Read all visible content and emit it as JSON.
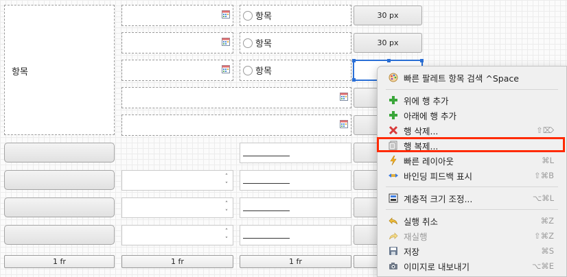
{
  "grid": {
    "left_label": "항목",
    "radio_label": "항목",
    "px_button": "30 px",
    "column_footers": [
      "1 fr",
      "1 fr",
      "1 fr"
    ]
  },
  "menu": {
    "items": [
      {
        "icon": "palette-icon",
        "label": "빠른 팔레트 항목 검색 ^Space",
        "shortcut": ""
      },
      {
        "icon": "add-green-icon",
        "label": "위에 행 추가",
        "shortcut": ""
      },
      {
        "icon": "add-green-icon",
        "label": "아래에 행 추가",
        "shortcut": ""
      },
      {
        "icon": "delete-red-x-icon",
        "label": "행 삭제...",
        "shortcut": "⇧⌦"
      },
      {
        "icon": "duplicate-document-icon",
        "label": "행 복제...",
        "shortcut": ""
      },
      {
        "icon": "lightning-icon",
        "label": "빠른 레이아웃",
        "shortcut": "⌘L"
      },
      {
        "icon": "binding-feedback-icon",
        "label": "바인딩 피드백 표시",
        "shortcut": "⇧⌘B"
      },
      {
        "icon": "resize-hierarchy-icon",
        "label": "계층적 크기 조정...",
        "shortcut": "⌥⌘L"
      },
      {
        "icon": "undo-icon",
        "label": "실행 취소",
        "shortcut": "⌘Z"
      },
      {
        "icon": "redo-icon",
        "label": "재실행",
        "shortcut": "⇧⌘Z",
        "disabled": true
      },
      {
        "icon": "save-disk-icon",
        "label": "저장",
        "shortcut": "⌘S"
      },
      {
        "icon": "camera-export-icon",
        "label": "이미지로 내보내기",
        "shortcut": "⌥⌘E"
      }
    ],
    "highlighted_item": "행 복제..."
  }
}
